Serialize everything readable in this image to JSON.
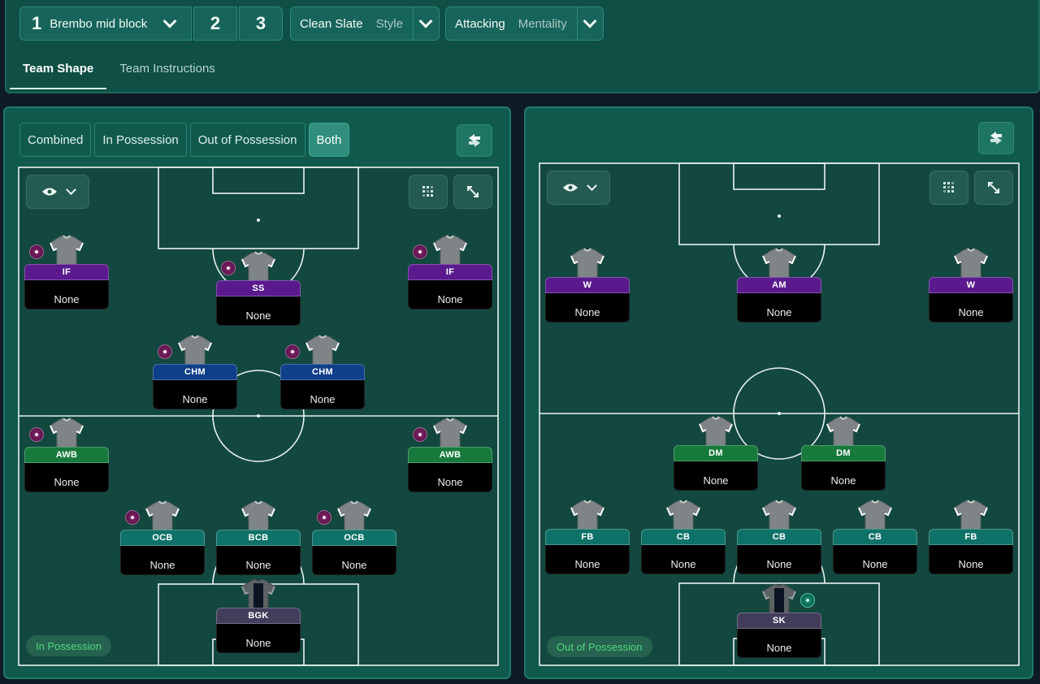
{
  "tactic_bar": {
    "tactic_number": "1",
    "tactic_name": "Brembo mid block",
    "alt_tactic_2": "2",
    "alt_tactic_3": "3",
    "style_value": "Clean Slate",
    "style_label": "Style",
    "mentality_value": "Attacking",
    "mentality_label": "Mentality"
  },
  "tabs": [
    "Team Shape",
    "Team Instructions"
  ],
  "view_modes": [
    "Combined",
    "In Possession",
    "Out of Possession",
    "Both"
  ],
  "active_view_mode": "Both",
  "colors": {
    "attack_role": "#5a1a8e",
    "midfield_role": "#0f3f8a",
    "wingback_role": "#177a3c",
    "defensive_role": "#0f7268",
    "gk_role": "#433d5c",
    "phase_label": "#55d77f"
  },
  "in_possession": {
    "phase_label": "In Possession",
    "players": [
      {
        "role": "IF",
        "duty": "None"
      },
      {
        "role": "SS",
        "duty": "None"
      },
      {
        "role": "IF",
        "duty": "None"
      },
      {
        "role": "CHM",
        "duty": "None"
      },
      {
        "role": "CHM",
        "duty": "None"
      },
      {
        "role": "AWB",
        "duty": "None"
      },
      {
        "role": "AWB",
        "duty": "None"
      },
      {
        "role": "OCB",
        "duty": "None"
      },
      {
        "role": "BCB",
        "duty": "None"
      },
      {
        "role": "OCB",
        "duty": "None"
      },
      {
        "role": "BGK",
        "duty": "None"
      }
    ]
  },
  "out_of_possession": {
    "phase_label": "Out of Possession",
    "players": [
      {
        "role": "W",
        "duty": "None"
      },
      {
        "role": "AM",
        "duty": "None"
      },
      {
        "role": "W",
        "duty": "None"
      },
      {
        "role": "DM",
        "duty": "None"
      },
      {
        "role": "DM",
        "duty": "None"
      },
      {
        "role": "FB",
        "duty": "None"
      },
      {
        "role": "CB",
        "duty": "None"
      },
      {
        "role": "CB",
        "duty": "None"
      },
      {
        "role": "CB",
        "duty": "None"
      },
      {
        "role": "FB",
        "duty": "None"
      },
      {
        "role": "SK",
        "duty": "None"
      }
    ]
  },
  "icons": {
    "chevron": "chevron-down-icon",
    "swap": "swap-icon",
    "eye": "eye-icon",
    "grid": "grid-icon",
    "expand": "expand-icon",
    "shirt": "shirt-icon"
  }
}
